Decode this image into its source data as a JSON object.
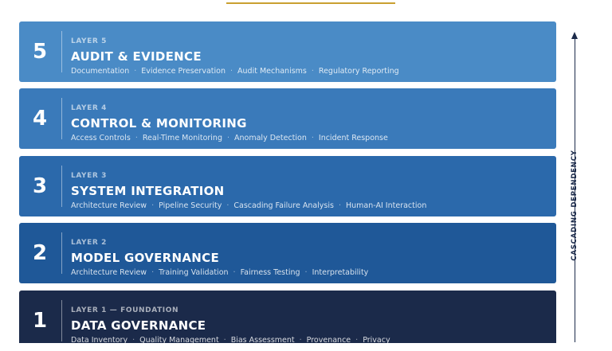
{
  "layers": [
    {
      "number": "5",
      "kicker": "LAYER 5",
      "title": "AUDIT & EVIDENCE",
      "color": "#4a8bc6",
      "items": [
        "Documentation",
        "Evidence Preservation",
        "Audit Mechanisms",
        "Regulatory Reporting"
      ]
    },
    {
      "number": "4",
      "kicker": "LAYER 4",
      "title": "CONTROL & MONITORING",
      "color": "#3a7aba",
      "items": [
        "Access Controls",
        "Real-Time Monitoring",
        "Anomaly Detection",
        "Incident Response"
      ]
    },
    {
      "number": "3",
      "kicker": "LAYER 3",
      "title": "SYSTEM INTEGRATION",
      "color": "#2b69ab",
      "items": [
        "Architecture Review",
        "Pipeline Security",
        "Cascading Failure Analysis",
        "Human-AI Interaction"
      ]
    },
    {
      "number": "2",
      "kicker": "LAYER 2",
      "title": "MODEL GOVERNANCE",
      "color": "#1f5898",
      "items": [
        "Architecture Review",
        "Training Validation",
        "Fairness Testing",
        "Interpretability"
      ]
    },
    {
      "number": "1",
      "kicker": "LAYER 1 — FOUNDATION",
      "title": "DATA GOVERNANCE",
      "color": "#1b2a4a",
      "items": [
        "Data Inventory",
        "Quality Management",
        "Bias Assessment",
        "Provenance",
        "Privacy"
      ]
    }
  ],
  "side_label": "CASCADING DEPENDENCY",
  "colors": {
    "accent_rule": "#c9a030",
    "arrow": "#1b2a4a"
  }
}
